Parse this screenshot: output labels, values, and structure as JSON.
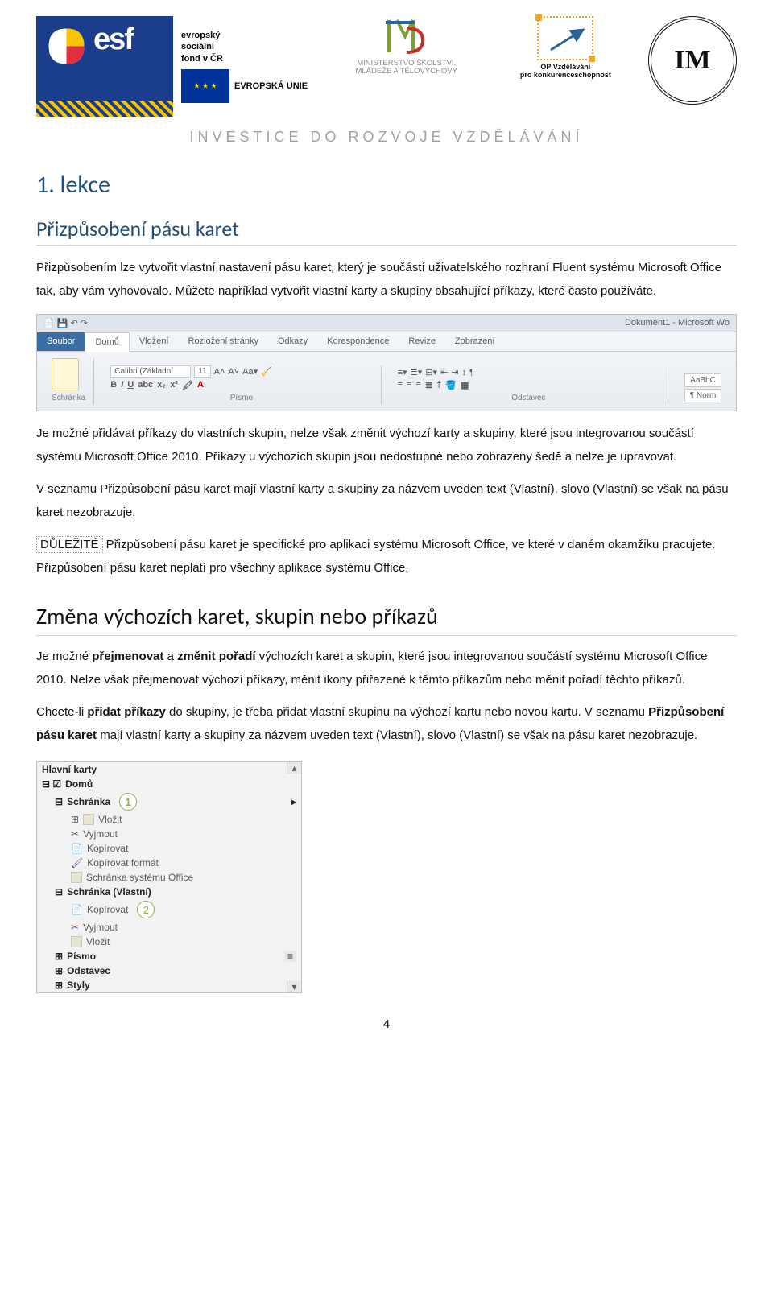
{
  "header": {
    "esf_abbrev": "esf",
    "esf_caption": "evropský\nsociální\nfond v ČR",
    "eu_caption": "EVROPSKÁ UNIE",
    "msmt_line1": "MINISTERSTVO ŠKOLSTVÍ,",
    "msmt_line2": "MLÁDEŽE A TĚLOVÝCHOVY",
    "op_line1": "OP Vzdělávání",
    "op_line2": "pro konkurenceschopnost",
    "uni_seal": "IM",
    "tagline": "INVESTICE DO ROZVOJE VZDĚLÁVÁNÍ"
  },
  "lesson": {
    "title": "1. lekce",
    "subtitle": "Přizpůsobení pásu karet",
    "p1": "Přizpůsobením lze vytvořit vlastní nastavení pásu karet, který je součástí uživatelského rozhraní Fluent systému Microsoft Office tak, aby vám vyhovovalo. Můžete například vytvořit vlastní karty a skupiny obsahující příkazy, které často používáte."
  },
  "ribbon": {
    "doc_title": "Dokument1 - Microsoft Wo",
    "file_tab": "Soubor",
    "tabs": [
      "Domů",
      "Vložení",
      "Rozložení stránky",
      "Odkazy",
      "Korespondence",
      "Revize",
      "Zobrazení"
    ],
    "font_name": "Calibri (Základní",
    "font_size": "11",
    "style1": "AaBbC",
    "style2": "¶ Norm",
    "group_labels": [
      "Schránka",
      "Písmo",
      "Odstavec"
    ]
  },
  "body": {
    "p2": "Je možné přidávat příkazy do vlastních skupin, nelze však změnit výchozí karty a skupiny, které jsou integrovanou součástí systému Microsoft Office 2010. Příkazy u výchozích skupin jsou nedostupné nebo zobrazeny šedě a nelze je upravovat.",
    "p3": "V seznamu Přizpůsobení pásu karet mají vlastní karty a skupiny za názvem uveden text (Vlastní), slovo (Vlastní) se však na pásu karet nezobrazuje.",
    "important_label": "DŮLEŽITÉ",
    "p4": "   Přizpůsobení pásu karet je specifické pro aplikaci systému Microsoft Office, ve které v daném okamžiku pracujete. Přizpůsobení pásu karet neplatí pro všechny aplikace systému Office.",
    "section2_title": "Změna výchozích karet, skupin nebo příkazů",
    "p5a": "Je možné ",
    "p5b": "přejmenovat",
    "p5c": " a ",
    "p5d": "změnit pořadí",
    "p5e": " výchozích karet a skupin, které jsou integrovanou součástí systému Microsoft Office 2010. Nelze však přejmenovat výchozí příkazy, měnit ikony přiřazené k těmto příkazům nebo měnit pořadí těchto příkazů.",
    "p6a": "Chcete-li ",
    "p6b": "přidat příkazy",
    "p6c": " do skupiny, je třeba přidat vlastní skupinu na výchozí kartu nebo novou kartu. V seznamu ",
    "p6d": "Přizpůsobení pásu karet",
    "p6e": " mají vlastní karty a skupiny za názvem uveden text (Vlastní), slovo (Vlastní) se však na pásu karet nezobrazuje."
  },
  "tree": {
    "header": "Hlavní karty",
    "domů": "Domů",
    "schranka": "Schránka",
    "vlozit": "Vložit",
    "vyjmout": "Vyjmout",
    "kopirovat": "Kopírovat",
    "kopirovat_format": "Kopírovat formát",
    "schranka_office": "Schránka systému Office",
    "schranka_vlastni": "Schránka (Vlastní)",
    "pismo": "Písmo",
    "odstavec": "Odstavec",
    "styly": "Styly",
    "num1": "1",
    "num2": "2"
  },
  "page_number": "4"
}
